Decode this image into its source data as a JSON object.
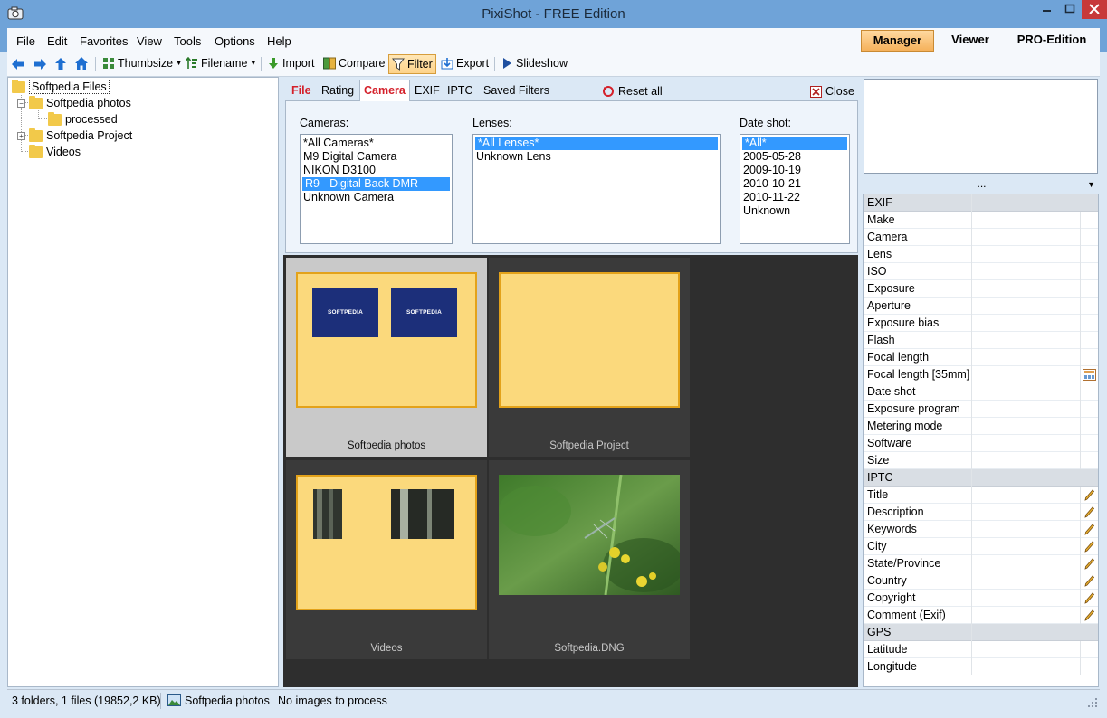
{
  "window": {
    "title": "PixiShot  -  FREE Edition"
  },
  "menu": [
    "File",
    "Edit",
    "Favorites",
    "View",
    "Tools",
    "Options",
    "Help"
  ],
  "modes": {
    "manager": "Manager",
    "viewer": "Viewer",
    "pro": "PRO-Edition"
  },
  "toolbar": {
    "thumbsize": "Thumbsize",
    "filename": "Filename",
    "import": "Import",
    "compare": "Compare",
    "filter": "Filter",
    "export": "Export",
    "slideshow": "Slideshow"
  },
  "tree": {
    "root": "Softpedia Files",
    "items": [
      "Softpedia photos",
      "processed",
      "Softpedia Project",
      "Videos"
    ]
  },
  "filter": {
    "tabs": [
      "File",
      "Rating",
      "Camera",
      "EXIF",
      "IPTC",
      "Saved Filters"
    ],
    "reset_all": "Reset all",
    "close": "Close",
    "cameras_label": "Cameras:",
    "cameras": [
      " *All Cameras*",
      "M9 Digital Camera",
      "NIKON D3100",
      "R9 - Digital Back DMR",
      "Unknown Camera"
    ],
    "lenses_label": "Lenses:",
    "lenses": [
      "*All Lenses*",
      "Unknown Lens"
    ],
    "dates_label": "Date shot:",
    "dates": [
      "*All*",
      "2005-05-28",
      "2009-10-19",
      "2010-10-21",
      "2010-11-22",
      "Unknown"
    ]
  },
  "thumbnails": {
    "captions": [
      "Softpedia photos",
      "Softpedia Project",
      "Videos",
      "Softpedia.DNG"
    ],
    "logo_text": "SOFTPEDIA"
  },
  "properties": {
    "header": "...",
    "exif_section": "EXIF",
    "exif": [
      "Make",
      "Camera",
      "Lens",
      "ISO",
      "Exposure",
      "Aperture",
      "Exposure bias",
      "Flash",
      "Focal length",
      "Focal length [35mm]",
      "Date shot",
      "Exposure program",
      "Metering mode",
      "Software",
      "Size"
    ],
    "iptc_section": "IPTC",
    "iptc": [
      "Title",
      "Description",
      "Keywords",
      "City",
      "State/Province",
      "Country",
      "Copyright",
      "Comment (Exif)"
    ],
    "gps_section": "GPS",
    "gps": [
      "Latitude",
      "Longitude"
    ]
  },
  "status": {
    "summary": "3 folders,  1 files  (19852,2 KB)",
    "folder": "Softpedia photos",
    "message": "No images to process"
  },
  "colors": {
    "accent": "#3399ff",
    "title_bar": "#6fa3d8",
    "active_tab": "#d4202a",
    "thumb_frame": "#fbd97c"
  }
}
